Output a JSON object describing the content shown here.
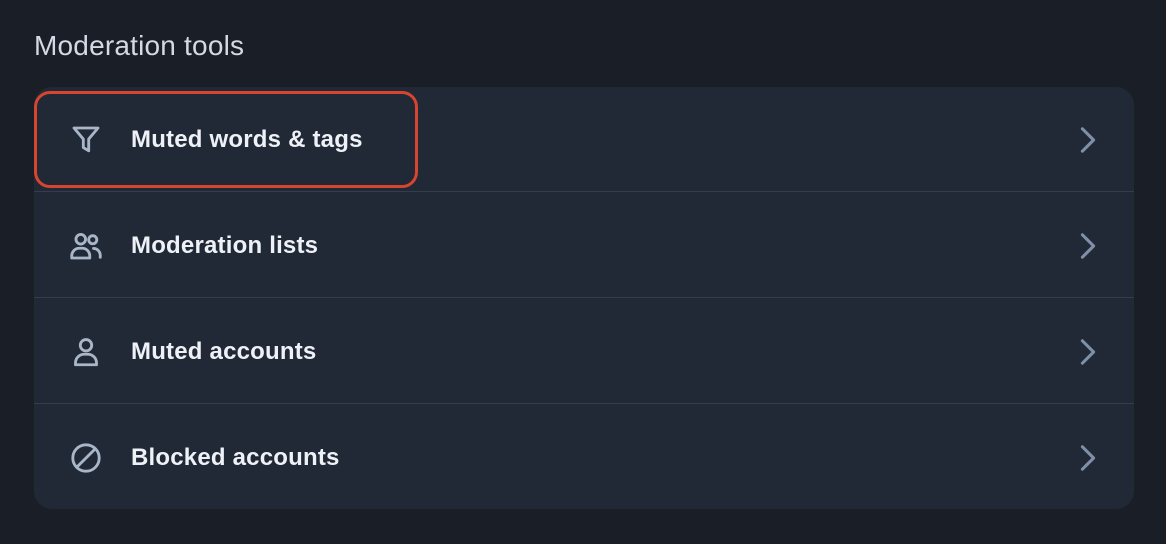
{
  "section": {
    "title": "Moderation tools"
  },
  "menu": {
    "items": [
      {
        "label": "Muted words & tags",
        "icon": "filter-icon",
        "highlighted": true
      },
      {
        "label": "Moderation lists",
        "icon": "users-icon",
        "highlighted": false
      },
      {
        "label": "Muted accounts",
        "icon": "person-icon",
        "highlighted": false
      },
      {
        "label": "Blocked accounts",
        "icon": "block-icon",
        "highlighted": false
      }
    ]
  },
  "colors": {
    "background": "#1a1f27",
    "card": "#212836",
    "highlight_border": "#d6452f",
    "icon": "#a9b6c7",
    "chevron": "#7f8fa7"
  }
}
